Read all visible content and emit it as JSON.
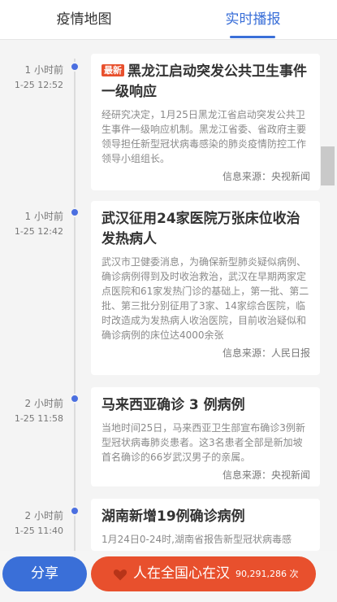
{
  "tabs": [
    {
      "label": "疫情地图",
      "active": false
    },
    {
      "label": "实时播报",
      "active": true
    }
  ],
  "colors": {
    "accent": "#3a6fd8",
    "badge": "#e8502d",
    "dot": "#4b6fe0"
  },
  "feed": [
    {
      "relative_time": "1 小时前",
      "timestamp": "1-25 12:52",
      "badge": "最新",
      "title": "黑龙江启动突发公共卫生事件一级响应",
      "body": "经研究决定，1月25日黑龙江省启动突发公共卫生事件一级响应机制。黑龙江省委、省政府主要领导担任新型冠状病毒感染的肺炎疫情防控工作领导小组组长。",
      "source": "信息来源：央视新闻"
    },
    {
      "relative_time": "1 小时前",
      "timestamp": "1-25 12:42",
      "title": "武汉征用24家医院万张床位收治发热病人",
      "body": "武汉市卫健委消息，为确保新型肺炎疑似病例、确诊病例得到及时收治救治，武汉在早期两家定点医院和61家发热门诊的基础上，第一批、第二批、第三批分别征用了3家、14家综合医院，临时改造成为发热病人收治医院，目前收治疑似和确诊病例的床位达4000余张",
      "source": "信息来源：人民日报"
    },
    {
      "relative_time": "2 小时前",
      "timestamp": "1-25 11:58",
      "title": "马来西亚确诊 3 例病例",
      "body": "当地时间25日，马来西亚卫生部宣布确诊3例新型冠状病毒肺炎患者。这3名患者全部是新加坡首名确诊的66岁武汉男子的亲属。",
      "source": "信息来源：央视新闻"
    },
    {
      "relative_time": "2 小时前",
      "timestamp": "1-25 11:40",
      "title": "湖南新增19例确诊病例",
      "body": "1月24日0-24时,湖南省报告新型冠状病毒感",
      "source": ""
    }
  ],
  "actions": {
    "share_label": "分享",
    "support_label": "人在全国心在汉",
    "support_count": "90,291,286 次",
    "heart_icon": "heart-icon"
  }
}
